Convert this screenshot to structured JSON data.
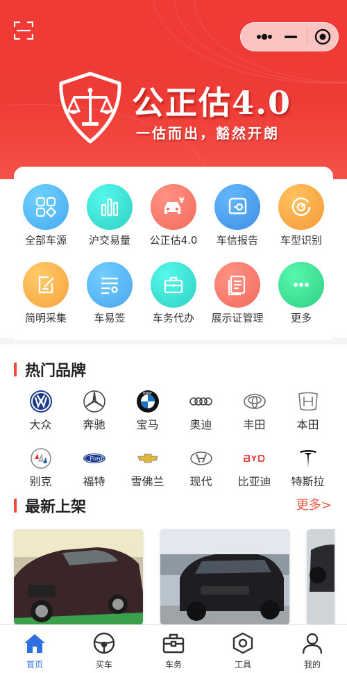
{
  "header": {
    "title": "公正估4.0",
    "slogan": "一估而出，豁然开朗"
  },
  "grid": {
    "items": [
      {
        "label": "全部车源",
        "icon": "all-cars-icon",
        "color": "#46a9ee"
      },
      {
        "label": "沪交易量",
        "icon": "bar-chart-icon",
        "color": "#2fd0c4"
      },
      {
        "label": "公正估4.0",
        "icon": "car-price-icon",
        "color": "#f26a5c"
      },
      {
        "label": "车信报告",
        "icon": "car-report-icon",
        "color": "#3d8fe0"
      },
      {
        "label": "车型识别",
        "icon": "car-recognize-icon",
        "color": "#f59a37"
      },
      {
        "label": "简明采集",
        "icon": "edit-icon",
        "color": "#f5a33f"
      },
      {
        "label": "车易签",
        "icon": "sign-list-icon",
        "color": "#4aa6ee"
      },
      {
        "label": "车务代办",
        "icon": "briefcase-icon",
        "color": "#2fd0c4"
      },
      {
        "label": "展示证管理",
        "icon": "document-icon",
        "color": "#f26a5c"
      },
      {
        "label": "更多",
        "icon": "more-dots-icon",
        "color": "#2fcf85"
      }
    ]
  },
  "brands": {
    "title": "热门品牌",
    "items": [
      {
        "name": "大众",
        "icon": "volkswagen-logo-icon"
      },
      {
        "name": "奔驰",
        "icon": "mercedes-logo-icon"
      },
      {
        "name": "宝马",
        "icon": "bmw-logo-icon"
      },
      {
        "name": "奥迪",
        "icon": "audi-logo-icon"
      },
      {
        "name": "丰田",
        "icon": "toyota-logo-icon"
      },
      {
        "name": "本田",
        "icon": "honda-logo-icon"
      },
      {
        "name": "别克",
        "icon": "buick-logo-icon"
      },
      {
        "name": "福特",
        "icon": "ford-logo-icon"
      },
      {
        "name": "雪佛兰",
        "icon": "chevrolet-logo-icon"
      },
      {
        "name": "现代",
        "icon": "hyundai-logo-icon"
      },
      {
        "name": "比亚迪",
        "icon": "byd-logo-icon"
      },
      {
        "name": "特斯拉",
        "icon": "tesla-logo-icon"
      }
    ]
  },
  "latest": {
    "title": "最新上架",
    "more": "更多>"
  },
  "tabbar": {
    "items": [
      {
        "label": "首页",
        "icon": "home-icon",
        "active": true
      },
      {
        "label": "买车",
        "icon": "steering-wheel-icon",
        "active": false
      },
      {
        "label": "车务",
        "icon": "briefcase-icon",
        "active": false
      },
      {
        "label": "工具",
        "icon": "hex-nut-icon",
        "active": false
      },
      {
        "label": "我的",
        "icon": "user-icon",
        "active": false
      }
    ]
  },
  "colors": {
    "brand_red": "#ef3b35",
    "accent_orange": "#e8573e",
    "tab_active": "#2f6fe0"
  }
}
